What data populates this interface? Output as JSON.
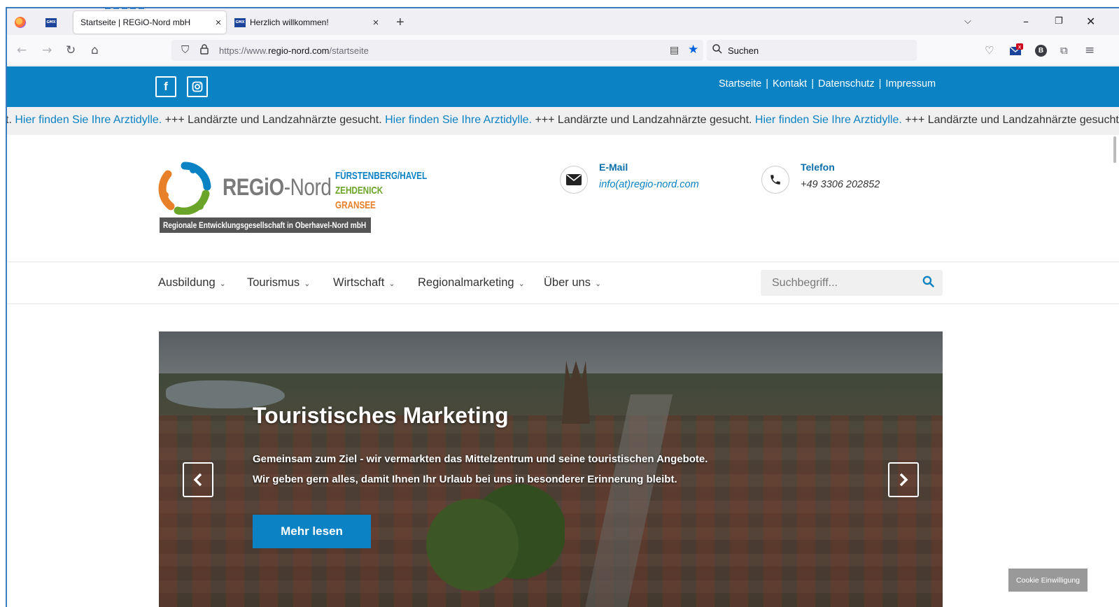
{
  "browser": {
    "tabs": [
      {
        "label": "Startseite | REGiO-Nord mbH",
        "active": true
      },
      {
        "label": "Herzlich willkommen!",
        "active": false
      }
    ],
    "gmx_badge": "GMX",
    "new_tab": "+",
    "url_prefix": "https://www.",
    "url_domain": "regio-nord.com",
    "url_path": "/startseite",
    "search_label": "Suchen",
    "profile_letter": "B"
  },
  "site": {
    "top_links": [
      "Startseite",
      "Kontakt",
      "Datenschutz",
      "Impressum"
    ],
    "social": {
      "facebook": "f"
    },
    "ticker": [
      {
        "text": "t. ",
        "blue": false
      },
      {
        "text": "Hier finden Sie Ihre Arztidylle.",
        "blue": true
      },
      {
        "text": " +++ Landärzte und Landzahnärzte gesucht. ",
        "blue": false
      },
      {
        "text": "Hier finden Sie Ihre Arztidylle.",
        "blue": true
      },
      {
        "text": " +++ Landärzte und Landzahnärzte gesucht. ",
        "blue": false
      },
      {
        "text": "Hier finden Sie Ihre Arztidylle.",
        "blue": true
      },
      {
        "text": " +++ Landärzte und Landzahnärzte gesucht.",
        "blue": false
      }
    ],
    "logo": {
      "name_bold": "REGiO",
      "name_rest": "-Nord",
      "towns": [
        "FÜRSTENBERG/HAVEL",
        "ZEHDENICK",
        "GRANSEE"
      ],
      "banner": "Regionale Entwicklungsgesellschaft in Oberhavel-Nord mbH"
    },
    "contact": {
      "email_title": "E-Mail",
      "email_value": "info(at)regio-nord.com",
      "phone_title": "Telefon",
      "phone_value": "+49 3306 202852"
    },
    "nav": [
      "Ausbildung",
      "Tourismus",
      "Wirtschaft",
      "Regionalmarketing",
      "Über uns"
    ],
    "search_placeholder": "Suchbegriff...",
    "hero": {
      "title": "Touristisches Marketing",
      "line1": "Gemeinsam zum Ziel - wir vermarkten das Mittelzentrum und seine touristischen Angebote.",
      "line2": "Wir geben gern alles, damit Ihnen Ihr Urlaub bei uns in besonderer Erinnerung bleibt.",
      "button": "Mehr lesen"
    },
    "cookie": "Cookie Einwilligung",
    "colors": {
      "primary": "#0a82c3",
      "topbar": "#0a82c3"
    }
  }
}
